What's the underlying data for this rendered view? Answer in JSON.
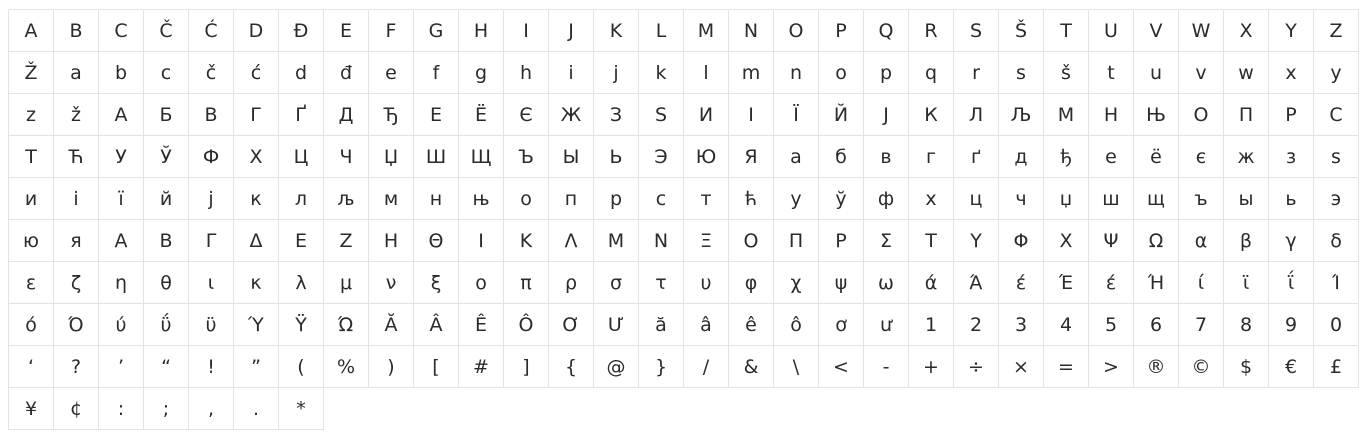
{
  "glyphs": [
    "A",
    "B",
    "C",
    "Č",
    "Ć",
    "D",
    "Đ",
    "E",
    "F",
    "G",
    "H",
    "I",
    "J",
    "K",
    "L",
    "M",
    "N",
    "O",
    "P",
    "Q",
    "R",
    "S",
    "Š",
    "T",
    "U",
    "V",
    "W",
    "X",
    "Y",
    "Z",
    "Ž",
    "a",
    "b",
    "c",
    "č",
    "ć",
    "d",
    "đ",
    "e",
    "f",
    "g",
    "h",
    "i",
    "j",
    "k",
    "l",
    "m",
    "n",
    "o",
    "p",
    "q",
    "r",
    "s",
    "š",
    "t",
    "u",
    "v",
    "w",
    "x",
    "y",
    "z",
    "ž",
    "А",
    "Б",
    "В",
    "Г",
    "Ґ",
    "Д",
    "Ђ",
    "Е",
    "Ё",
    "Є",
    "Ж",
    "З",
    "S",
    "И",
    "І",
    "Ї",
    "Й",
    "Ј",
    "К",
    "Л",
    "Љ",
    "М",
    "Н",
    "Њ",
    "О",
    "П",
    "Р",
    "С",
    "Т",
    "Ћ",
    "У",
    "Ў",
    "Ф",
    "Х",
    "Ц",
    "Ч",
    "Џ",
    "Ш",
    "Щ",
    "Ъ",
    "Ы",
    "Ь",
    "Э",
    "Ю",
    "Я",
    "а",
    "б",
    "в",
    "г",
    "ґ",
    "д",
    "ђ",
    "е",
    "ё",
    "є",
    "ж",
    "з",
    "s",
    "и",
    "і",
    "ї",
    "й",
    "ј",
    "к",
    "л",
    "љ",
    "м",
    "н",
    "њ",
    "о",
    "п",
    "р",
    "с",
    "т",
    "ћ",
    "у",
    "ў",
    "ф",
    "х",
    "ц",
    "ч",
    "џ",
    "ш",
    "щ",
    "ъ",
    "ы",
    "ь",
    "э",
    "ю",
    "я",
    "Α",
    "Β",
    "Γ",
    "Δ",
    "Ε",
    "Ζ",
    "Η",
    "Θ",
    "Ι",
    "Κ",
    "Λ",
    "Μ",
    "Ν",
    "Ξ",
    "Ο",
    "Π",
    "Ρ",
    "Σ",
    "Τ",
    "Υ",
    "Φ",
    "Χ",
    "Ψ",
    "Ω",
    "α",
    "β",
    "γ",
    "δ",
    "ε",
    "ζ",
    "η",
    "θ",
    "ι",
    "κ",
    "λ",
    "μ",
    "ν",
    "ξ",
    "ο",
    "π",
    "ρ",
    "σ",
    "τ",
    "υ",
    "φ",
    "χ",
    "ψ",
    "ω",
    "ά",
    "Ά",
    "έ",
    "Έ",
    "έ",
    "Ή",
    "ί",
    "ϊ",
    "ΐ",
    "Ί",
    "ό",
    "Ό",
    "ύ",
    "ΰ",
    "ϋ",
    "Ύ",
    "Ϋ",
    "Ώ",
    "Ă",
    "Â",
    "Ê",
    "Ô",
    "Ơ",
    "Ư",
    "ă",
    "â",
    "ê",
    "ô",
    "ơ",
    "ư",
    "1",
    "2",
    "3",
    "4",
    "5",
    "6",
    "7",
    "8",
    "9",
    "0",
    "‘",
    "?",
    "’",
    "“",
    "!",
    "”",
    "(",
    "%",
    ")",
    "[",
    "#",
    "]",
    "{",
    "@",
    "}",
    "/",
    "&",
    "\\",
    "<",
    "-",
    "+",
    "÷",
    "×",
    "=",
    ">",
    "®",
    "©",
    "$",
    "€",
    "£",
    "¥",
    "¢",
    ":",
    ";",
    ",",
    ".",
    "*"
  ]
}
